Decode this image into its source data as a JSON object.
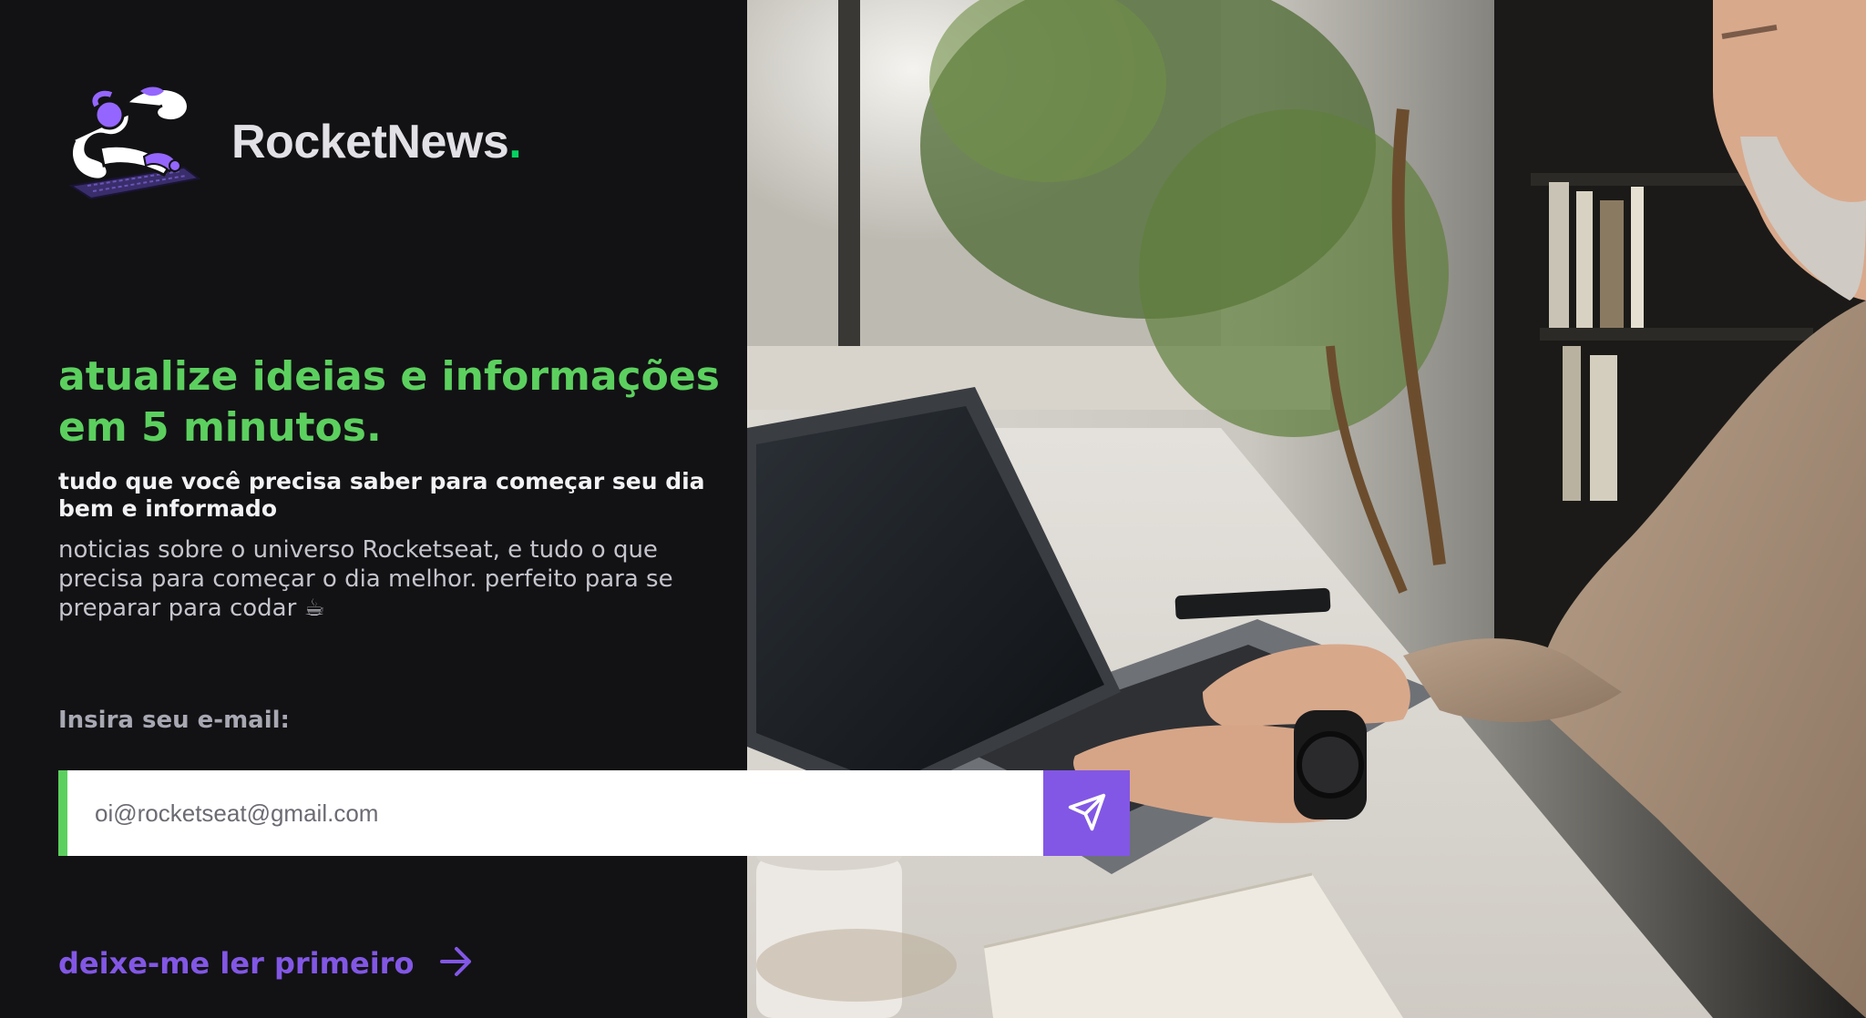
{
  "brand": {
    "name": "RocketNews",
    "dot": "."
  },
  "hero": {
    "headline": "atualize ideias e informações em 5 minutos.",
    "subheadline": "tudo que você precisa saber para começar seu dia bem e informado",
    "description": "noticias sobre o universo Rocketseat, e tudo o que precisa para começar o dia melhor. perfeito para se preparar para codar ☕"
  },
  "form": {
    "label": "Insira seu e-mail:",
    "email_placeholder": "oi@rocketseat@gmail.com",
    "send_icon": "send-icon"
  },
  "cta": {
    "read_first_label": "deixe-me ler primeiro",
    "arrow_icon": "arrow-right-icon"
  },
  "photo": {
    "subject": "man-typing-on-laptop"
  },
  "colors": {
    "background": "#121214",
    "accent_green": "#5cd05f",
    "accent_purple": "#8257e5",
    "text_light": "#e1e1e6",
    "text_muted": "#a8a8b3"
  }
}
